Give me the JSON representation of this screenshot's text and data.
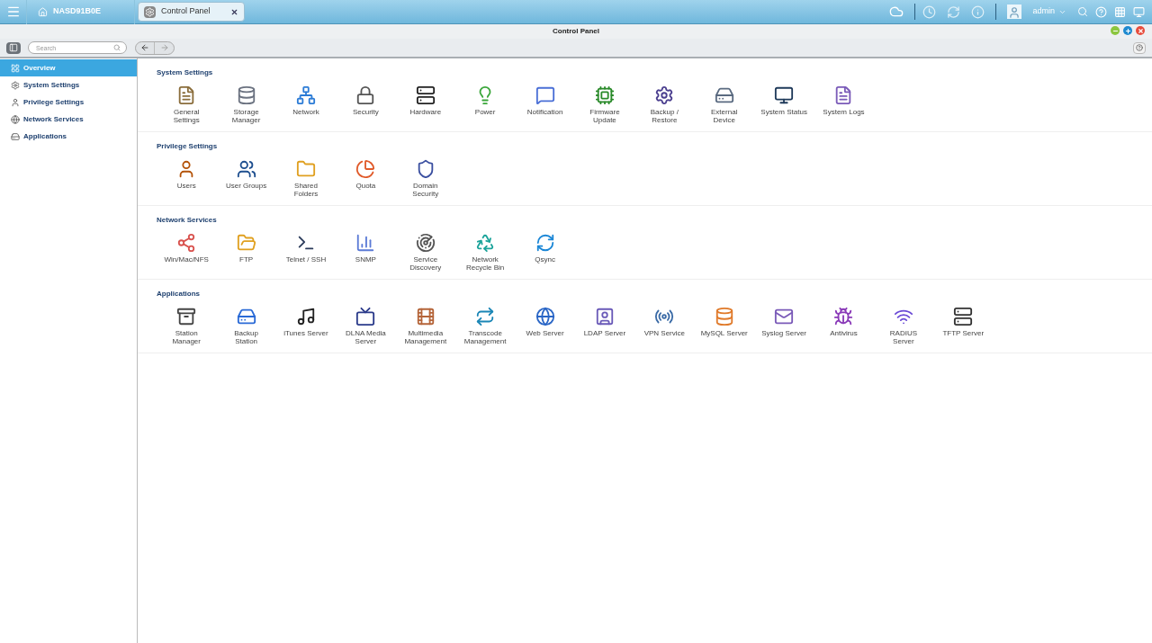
{
  "taskbar": {
    "host": "NASD91B0E",
    "tabs": [
      {
        "label": "Control Panel",
        "selected": true
      }
    ],
    "user": "admin"
  },
  "window": {
    "title": "Control Panel"
  },
  "search": {
    "placeholder": "Search"
  },
  "sidebar": {
    "items": [
      {
        "label": "Overview",
        "selected": true
      },
      {
        "label": "System Settings",
        "selected": false
      },
      {
        "label": "Privilege Settings",
        "selected": false
      },
      {
        "label": "Network Services",
        "selected": false
      },
      {
        "label": "Applications",
        "selected": false
      }
    ]
  },
  "sections": [
    {
      "title": "System Settings",
      "items": [
        {
          "lines": [
            "General",
            "Settings"
          ]
        },
        {
          "lines": [
            "Storage",
            "Manager"
          ]
        },
        {
          "lines": [
            "Network"
          ]
        },
        {
          "lines": [
            "Security"
          ]
        },
        {
          "lines": [
            "Hardware"
          ]
        },
        {
          "lines": [
            "Power"
          ]
        },
        {
          "lines": [
            "Notification"
          ]
        },
        {
          "lines": [
            "Firmware",
            "Update"
          ]
        },
        {
          "lines": [
            "Backup /",
            "Restore"
          ]
        },
        {
          "lines": [
            "External",
            "Device"
          ]
        },
        {
          "lines": [
            "System Status"
          ]
        },
        {
          "lines": [
            "System Logs"
          ]
        }
      ]
    },
    {
      "title": "Privilege Settings",
      "items": [
        {
          "lines": [
            "Users"
          ]
        },
        {
          "lines": [
            "User Groups"
          ]
        },
        {
          "lines": [
            "Shared",
            "Folders"
          ]
        },
        {
          "lines": [
            "Quota"
          ]
        },
        {
          "lines": [
            "Domain",
            "Security"
          ]
        }
      ]
    },
    {
      "title": "Network Services",
      "items": [
        {
          "lines": [
            "Win/Mac/NFS"
          ]
        },
        {
          "lines": [
            "FTP"
          ]
        },
        {
          "lines": [
            "Telnet / SSH"
          ]
        },
        {
          "lines": [
            "SNMP"
          ]
        },
        {
          "lines": [
            "Service",
            "Discovery"
          ]
        },
        {
          "lines": [
            "Network",
            "Recycle Bin"
          ]
        },
        {
          "lines": [
            "Qsync"
          ]
        }
      ]
    },
    {
      "title": "Applications",
      "items": [
        {
          "lines": [
            "Station",
            "Manager"
          ]
        },
        {
          "lines": [
            "Backup",
            "Station"
          ]
        },
        {
          "lines": [
            "iTunes Server"
          ]
        },
        {
          "lines": [
            "DLNA Media",
            "Server"
          ]
        },
        {
          "lines": [
            "Multimedia",
            "Management"
          ]
        },
        {
          "lines": [
            "Transcode",
            "Management"
          ]
        },
        {
          "lines": [
            "Web Server"
          ]
        },
        {
          "lines": [
            "LDAP Server"
          ]
        },
        {
          "lines": [
            "VPN Service"
          ]
        },
        {
          "lines": [
            "MySQL Server"
          ]
        },
        {
          "lines": [
            "Syslog Server"
          ]
        },
        {
          "lines": [
            "Antivirus"
          ]
        },
        {
          "lines": [
            "RADIUS",
            "Server"
          ]
        },
        {
          "lines": [
            "TFTP Server"
          ]
        }
      ]
    }
  ]
}
